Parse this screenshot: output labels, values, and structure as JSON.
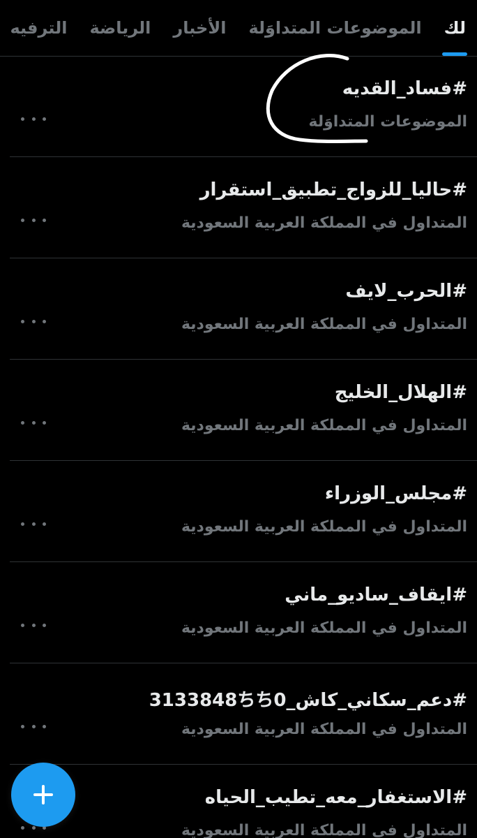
{
  "tabs": [
    {
      "label": "لك",
      "active": true
    },
    {
      "label": "الموضوعات المتداوَلة",
      "active": false
    },
    {
      "label": "الأخبار",
      "active": false
    },
    {
      "label": "الرياضة",
      "active": false
    },
    {
      "label": "الترفيه",
      "active": false
    }
  ],
  "trends": [
    {
      "hashtag": "#فساد_القديه",
      "context": "الموضوعات المتداوَلة"
    },
    {
      "hashtag": "#حاليا_للزواج_تطبيق_استقرار",
      "context": "المتداول في المملكة العربية السعودية"
    },
    {
      "hashtag": "#الحرب_لايف",
      "context": "المتداول في المملكة العربية السعودية"
    },
    {
      "hashtag": "#الهلال_الخليج",
      "context": "المتداول في المملكة العربية السعودية"
    },
    {
      "hashtag": "#مجلس_الوزراء",
      "context": "المتداول في المملكة العربية السعودية"
    },
    {
      "hashtag": "#ايقاف_ساديو_ماني",
      "context": "المتداول في المملكة العربية السعودية"
    },
    {
      "hashtag": "#دعم_سكاني_كاش_3133848ちち0",
      "context": "المتداول في المملكة العربية السعودية"
    },
    {
      "hashtag": "#الاستغفار_معه_تطيب_الحياه",
      "context": "المتداول في المملكة العربية السعودية"
    }
  ],
  "icons": {
    "more": "more-horizontal-icon",
    "compose": "plus-icon"
  },
  "colors": {
    "background": "#000000",
    "text_primary": "#e7e9ea",
    "text_secondary": "#71767b",
    "accent": "#1d9bf0",
    "divider": "#2f3336",
    "annotation": "#ffffff"
  }
}
